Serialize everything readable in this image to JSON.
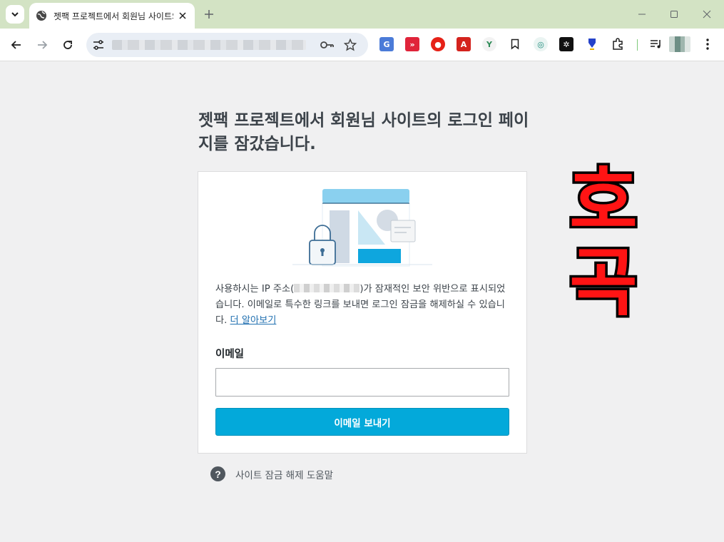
{
  "browser": {
    "tab_title": "젯팩 프로젝트에서 회원님 사이트의 로그인 페이지를 잠갔습니다.",
    "new_tab_label": "+",
    "window_buttons": [
      "minimize-icon",
      "maximize-icon",
      "close-icon"
    ],
    "toolbar_icons": [
      "back-icon",
      "forward-icon",
      "reload-icon",
      "site-settings-icon",
      "password-key-icon",
      "bookmark-star-icon"
    ],
    "extensions": [
      "translate-icon",
      "video-speed-icon",
      "ad-block-icon",
      "pdf-icon",
      "leaf-icon",
      "bookmark-icon",
      "vpn-icon",
      "ai-icon",
      "download-arrow-icon",
      "extensions-puzzle-icon",
      "reading-list-icon",
      "profile-avatar-icon",
      "menu-dots-icon"
    ],
    "accent_color": "#d3e3c4"
  },
  "page": {
    "heading": "젯팩 프로젝트에서 회원님 사이트의 로그인 페이지를 잠갔습니다.",
    "message_before_ip": "사용하시는 IP 주소(",
    "message_after_ip": ")가 잠재적인 보안 위반으로 표시되었습니다. 이메일로 특수한 링크를 보내면 로그인 잠금을 해제하실 수 있습니다. ",
    "learn_more_link": "더 알아보기",
    "email_label": "이메일",
    "email_value": "",
    "send_button": "이메일 보내기",
    "help_link": "사이트 잠금 해제 도움말",
    "button_color": "#03a9da"
  },
  "overlay": {
    "line1": "호",
    "line2": "곡",
    "color": "#ff1414"
  }
}
